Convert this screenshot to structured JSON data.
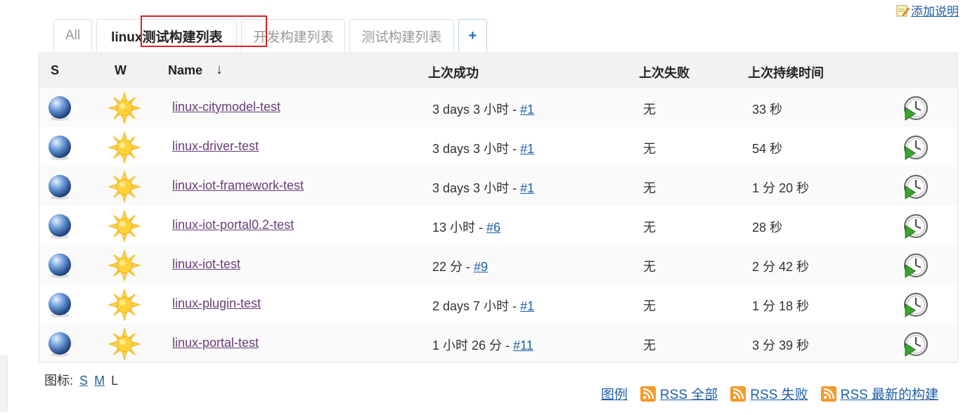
{
  "top_link": "添加说明",
  "tabs": [
    "All",
    "linux测试构建列表",
    "开发构建列表",
    "测试构建列表",
    "+"
  ],
  "columns": {
    "s": "S",
    "w": "W",
    "name": "Name",
    "sort": "↓",
    "last_success": "上次成功",
    "last_failure": "上次失败",
    "last_duration": "上次持续时间"
  },
  "jobs": [
    {
      "name": "linux-citymodel-test",
      "success_time": "3 days 3 小时 - ",
      "build": "#1",
      "failure": "无",
      "duration": "33 秒"
    },
    {
      "name": "linux-driver-test",
      "success_time": "3 days 3 小时 - ",
      "build": "#1",
      "failure": "无",
      "duration": "54 秒"
    },
    {
      "name": "linux-iot-framework-test",
      "success_time": "3 days 3 小时 - ",
      "build": "#1",
      "failure": "无",
      "duration": "1 分 20 秒"
    },
    {
      "name": "linux-iot-portal0.2-test",
      "success_time": "13 小时 - ",
      "build": "#6",
      "failure": "无",
      "duration": "28 秒"
    },
    {
      "name": "linux-iot-test",
      "success_time": "22 分 - ",
      "build": "#9",
      "failure": "无",
      "duration": "2 分 42 秒"
    },
    {
      "name": "linux-plugin-test",
      "success_time": "2 days 7 小时 - ",
      "build": "#1",
      "failure": "无",
      "duration": "1 分 18 秒"
    },
    {
      "name": "linux-portal-test",
      "success_time": "1 小时 26 分 - ",
      "build": "#11",
      "failure": "无",
      "duration": "3 分 39 秒"
    }
  ],
  "icon_size": {
    "label": "图标:",
    "s": "S",
    "m": "M",
    "l": "L"
  },
  "footer": {
    "legend": "图例",
    "rss_all": "RSS 全部",
    "rss_failed": "RSS 失败",
    "rss_latest": "RSS 最新的构建"
  },
  "icons": {
    "status": "blue-ball-icon",
    "weather": "sun-icon",
    "schedule": "schedule-build-icon",
    "rss": "rss-icon",
    "note": "note-icon"
  },
  "colors": {
    "link": "#1f5fa6",
    "visited_link": "#6a3d7a",
    "highlight": "#e02020",
    "rss": "#f39a2b"
  }
}
